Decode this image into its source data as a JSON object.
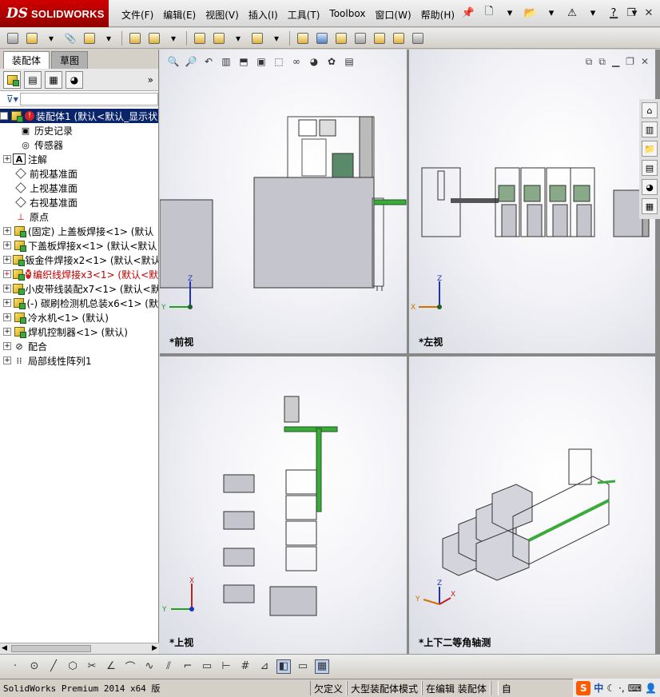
{
  "app": {
    "logo_ds": "DS",
    "logo_name": "SOLIDWORKS"
  },
  "menu": [
    "文件(F)",
    "编辑(E)",
    "视图(V)",
    "插入(I)",
    "工具(T)",
    "Toolbox",
    "窗口(W)",
    "帮助(H)"
  ],
  "left_panel": {
    "tabs": [
      "装配体",
      "草图"
    ],
    "tree": [
      {
        "label": "装配体1  (默认<默认_显示状",
        "type": "root",
        "state": "selected"
      },
      {
        "label": "历史记录",
        "type": "folder"
      },
      {
        "label": "传感器",
        "type": "folder"
      },
      {
        "label": "注解",
        "type": "folder",
        "expandable": true
      },
      {
        "label": "前视基准面",
        "type": "plane"
      },
      {
        "label": "上视基准面",
        "type": "plane"
      },
      {
        "label": "右视基准面",
        "type": "plane"
      },
      {
        "label": "原点",
        "type": "origin"
      },
      {
        "label": "(固定) 上盖板焊接<1> (默认",
        "type": "part",
        "expandable": true
      },
      {
        "label": "下盖板焊接x<1> (默认<默认",
        "type": "part",
        "expandable": true
      },
      {
        "label": "钣金件焊接x2<1> (默认<默认",
        "type": "part",
        "expandable": true
      },
      {
        "label": "编织线焊接x3<1> (默认<默",
        "type": "part",
        "expandable": true,
        "state": "error"
      },
      {
        "label": "小皮带线装配x7<1> (默认<默",
        "type": "part",
        "expandable": true
      },
      {
        "label": "(-) 碳刷检测机总装x6<1> (默",
        "type": "part",
        "expandable": true
      },
      {
        "label": "冷水机<1> (默认)",
        "type": "part",
        "expandable": true
      },
      {
        "label": "焊机控制器<1> (默认)",
        "type": "part",
        "expandable": true
      },
      {
        "label": "配合",
        "type": "mates",
        "expandable": true
      },
      {
        "label": "局部线性阵列1",
        "type": "pattern",
        "expandable": true
      }
    ]
  },
  "viewports": [
    {
      "label": "*前视",
      "axes": {
        "v": "Z",
        "h": "Y"
      }
    },
    {
      "label": "*左视",
      "axes": {
        "v": "Z",
        "h": "X"
      }
    },
    {
      "label": "*上视",
      "axes": {
        "v": "X",
        "h": "Y"
      }
    },
    {
      "label": "*上下二等角轴测",
      "axes": {
        "v": "Z",
        "h1": "Y",
        "h2": "X"
      }
    }
  ],
  "statusbar": {
    "product": "SolidWorks Premium 2014 x64 版",
    "cells": [
      "欠定义",
      "大型装配体模式",
      "在编辑 装配体",
      "",
      "自"
    ],
    "ime_label": "中"
  }
}
